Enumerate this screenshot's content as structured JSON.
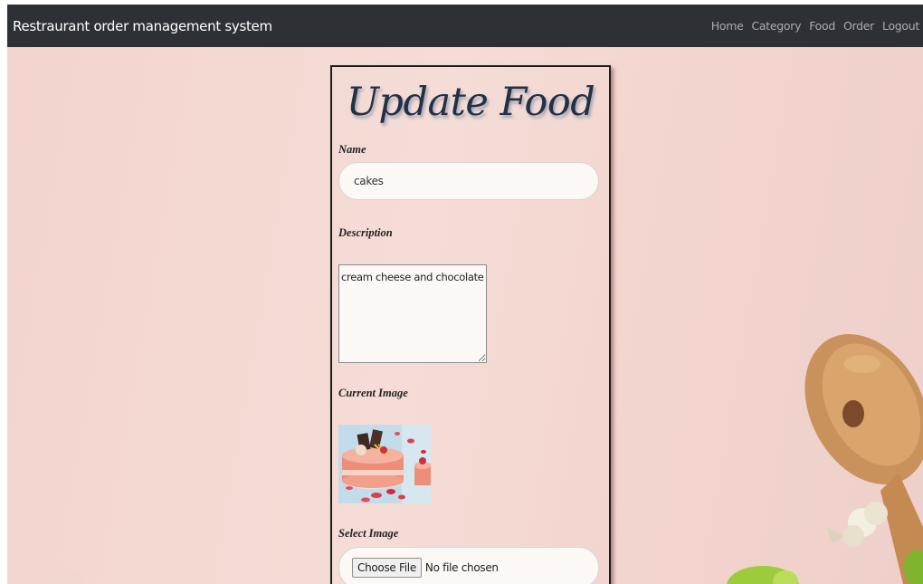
{
  "navbar": {
    "brand": "Restraurant order management system",
    "links": [
      "Home",
      "Category",
      "Food",
      "Order",
      "Logout"
    ]
  },
  "form": {
    "title": "Update Food",
    "name_label": "Name",
    "name_value": "cakes",
    "description_label": "Description",
    "description_value": "cream cheese and chocolate",
    "current_image_label": "Current Image",
    "select_image_label": "Select Image",
    "choose_file_label": "Choose File",
    "file_status": "No file chosen"
  }
}
